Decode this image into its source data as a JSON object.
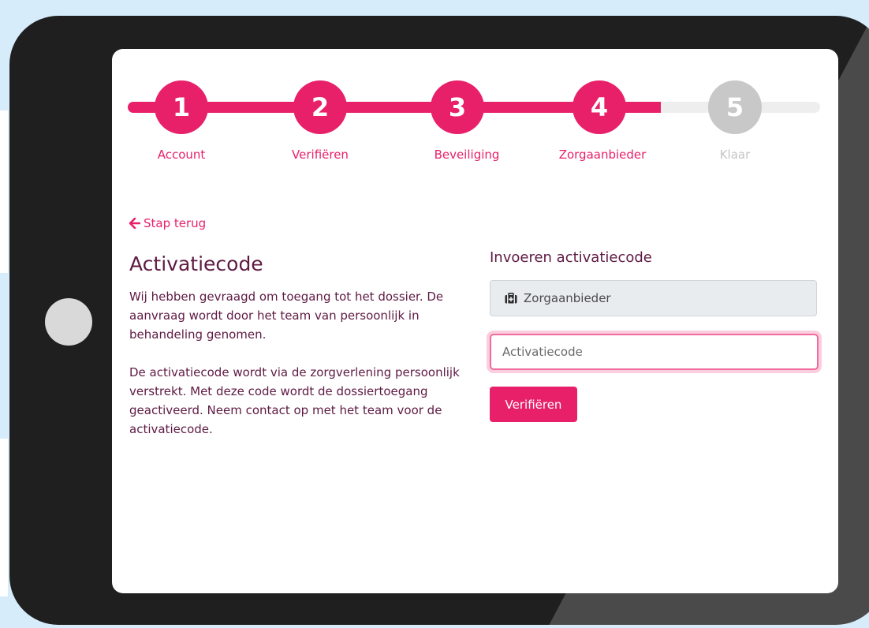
{
  "colors": {
    "accent": "#e8206a",
    "text_dark": "#5e1a43",
    "inactive": "#c8c8c8",
    "device_frame": "#1f1f1f",
    "page_background": "#d6ecfb"
  },
  "stepper": {
    "progress_percent": 77,
    "steps": [
      {
        "number": "1",
        "label": "Account",
        "status": "done"
      },
      {
        "number": "2",
        "label": "Verifiëren",
        "status": "done"
      },
      {
        "number": "3",
        "label": "Beveiliging",
        "status": "done"
      },
      {
        "number": "4",
        "label": "Zorgaanbieder",
        "status": "current"
      },
      {
        "number": "5",
        "label": "Klaar",
        "status": "todo"
      }
    ]
  },
  "back_link": {
    "icon": "arrow-left-icon",
    "label": "Stap terug"
  },
  "left": {
    "title": "Activatiecode",
    "paragraph1": "Wij hebben gevraagd om toegang tot het dossier. De aanvraag wordt door het team van persoonlijk in behandeling genomen.",
    "paragraph2": "De activatiecode wordt via de zorgverlening persoonlijk verstrekt. Met deze code wordt de dossiertoegang geactiveerd. Neem contact op met het team voor de activatiecode."
  },
  "form": {
    "title": "Invoeren activatiecode",
    "provider_icon": "medical-kit-icon",
    "provider_value": "Zorgaanbieder",
    "code_placeholder": "Activatiecode",
    "code_value": "",
    "submit_label": "Verifiëren"
  }
}
